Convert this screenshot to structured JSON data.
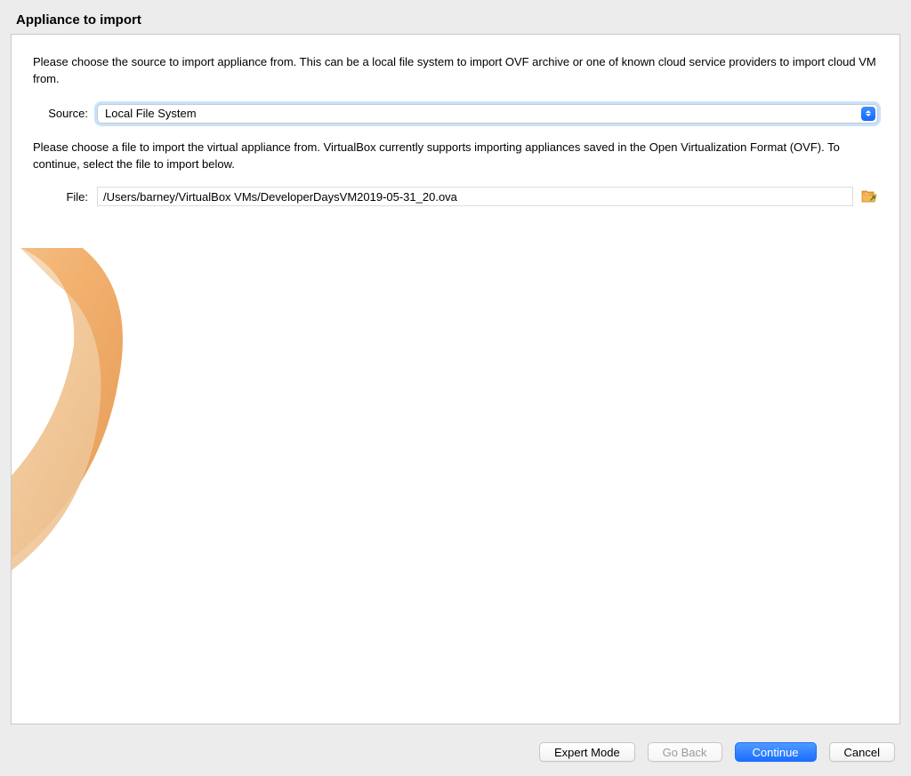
{
  "title": "Appliance to import",
  "intro": "Please choose the source to import appliance from. This can be a local file system to import OVF archive or one of known cloud service providers to import cloud VM from.",
  "source": {
    "label": "Source:",
    "selected": "Local File System"
  },
  "fileDesc": "Please choose a file to import the virtual appliance from. VirtualBox currently supports importing appliances saved in the Open Virtualization Format (OVF). To continue, select the file to import below.",
  "file": {
    "label": "File:",
    "value": "/Users/barney/VirtualBox VMs/DeveloperDaysVM2019-05-31_20.ova"
  },
  "buttons": {
    "expert": "Expert Mode",
    "goback": "Go Back",
    "continue": "Continue",
    "cancel": "Cancel"
  }
}
